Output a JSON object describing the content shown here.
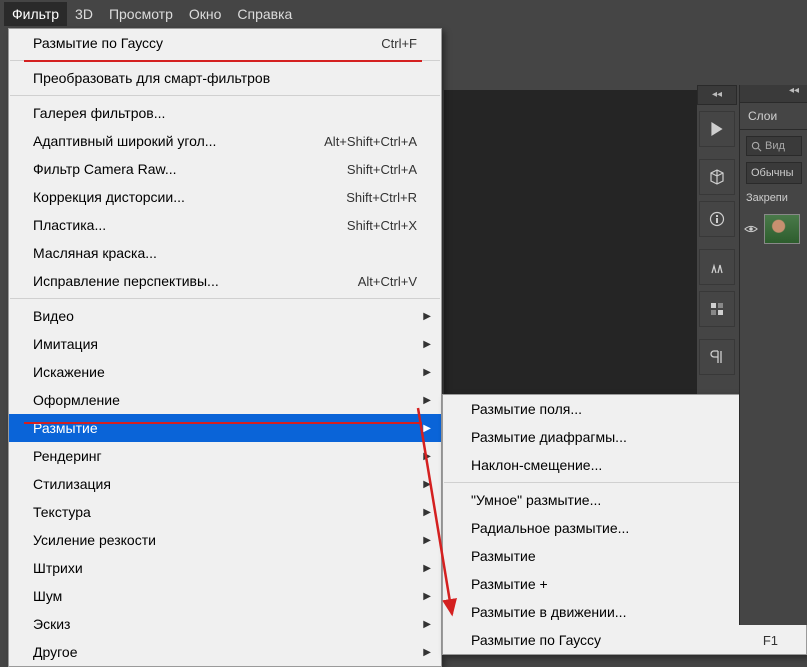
{
  "menubar": {
    "items": [
      "Фильтр",
      "3D",
      "Просмотр",
      "Окно",
      "Справка"
    ],
    "active_index": 0
  },
  "dropdown": {
    "groups": [
      [
        {
          "label": "Размытие по Гауссу",
          "shortcut": "Ctrl+F",
          "underline": true
        }
      ],
      [
        {
          "label": "Преобразовать для смарт-фильтров"
        }
      ],
      [
        {
          "label": "Галерея фильтров..."
        },
        {
          "label": "Адаптивный широкий угол...",
          "shortcut": "Alt+Shift+Ctrl+A"
        },
        {
          "label": "Фильтр Camera Raw...",
          "shortcut": "Shift+Ctrl+A"
        },
        {
          "label": "Коррекция дисторсии...",
          "shortcut": "Shift+Ctrl+R"
        },
        {
          "label": "Пластика...",
          "shortcut": "Shift+Ctrl+X"
        },
        {
          "label": "Масляная краска..."
        },
        {
          "label": "Исправление перспективы...",
          "shortcut": "Alt+Ctrl+V"
        }
      ],
      [
        {
          "label": "Видео",
          "submenu": true
        },
        {
          "label": "Имитация",
          "submenu": true
        },
        {
          "label": "Искажение",
          "submenu": true
        },
        {
          "label": "Оформление",
          "submenu": true
        },
        {
          "label": "Размытие",
          "submenu": true,
          "highlighted": true,
          "underline": true
        },
        {
          "label": "Рендеринг",
          "submenu": true
        },
        {
          "label": "Стилизация",
          "submenu": true
        },
        {
          "label": "Текстура",
          "submenu": true
        },
        {
          "label": "Усиление резкости",
          "submenu": true
        },
        {
          "label": "Штрихи",
          "submenu": true
        },
        {
          "label": "Шум",
          "submenu": true
        },
        {
          "label": "Эскиз",
          "submenu": true
        },
        {
          "label": "Другое",
          "submenu": true
        }
      ]
    ]
  },
  "submenu": {
    "groups": [
      [
        {
          "label": "Размытие поля..."
        },
        {
          "label": "Размытие диафрагмы..."
        },
        {
          "label": "Наклон-смещение..."
        }
      ],
      [
        {
          "label": "\"Умное\" размытие..."
        },
        {
          "label": "Радиальное размытие..."
        },
        {
          "label": "Размытие"
        },
        {
          "label": "Размытие +"
        },
        {
          "label": "Размытие в движении..."
        },
        {
          "label": "Размытие по Гауссу",
          "shortcut": "F1",
          "cut": true
        }
      ]
    ]
  },
  "right_panel": {
    "collapse": "◂◂",
    "tab": "Слои",
    "search_placeholder": "Вид",
    "blend_mode": "Обычны",
    "lock_label": "Закрепи"
  },
  "tool_icons": [
    "play",
    "cube",
    "info",
    "brushes",
    "char",
    "para"
  ]
}
